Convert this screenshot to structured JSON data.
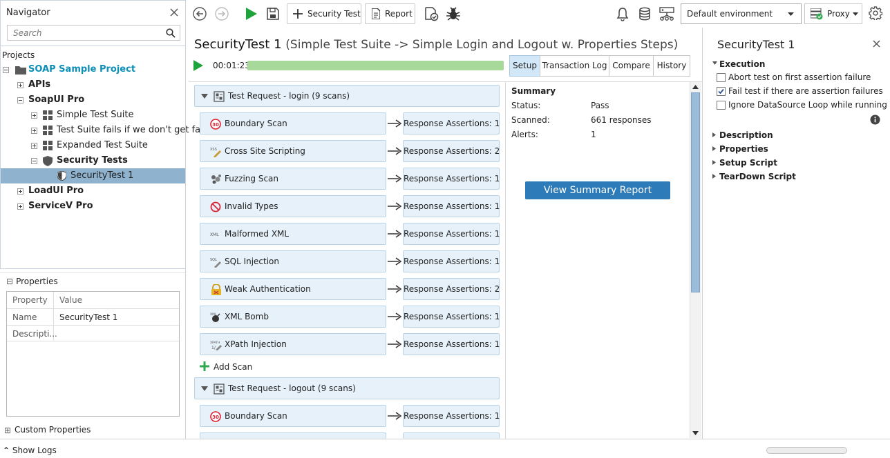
{
  "navigator": {
    "title": "Navigator",
    "search_placeholder": "Search",
    "projects_label": "Projects",
    "tree": [
      {
        "label": "SOAP Sample Project",
        "style": "teal-bold"
      },
      {
        "label": "APIs",
        "style": "bold"
      },
      {
        "label": "SoapUI Pro",
        "style": "bold"
      },
      {
        "label": "Simple Test Suite",
        "style": "normal"
      },
      {
        "label": "Test Suite fails if we don't get fa...",
        "style": "normal"
      },
      {
        "label": "Expanded Test Suite",
        "style": "normal"
      },
      {
        "label": "Security Tests",
        "style": "bold"
      },
      {
        "label": "SecurityTest 1",
        "style": "selected"
      },
      {
        "label": "LoadUI Pro",
        "style": "bold"
      },
      {
        "label": "ServiceV Pro",
        "style": "bold"
      }
    ]
  },
  "properties_panel": {
    "title": "Properties",
    "col_property": "Property",
    "col_value": "Value",
    "rows": [
      {
        "property": "Name",
        "value": "SecurityTest 1"
      },
      {
        "property": "Descripti...",
        "value": ""
      }
    ],
    "custom_properties": "Custom Properties"
  },
  "show_logs": "Show Logs",
  "toolbar": {
    "security_test_label": "Security Test",
    "report_label": "Report",
    "environment": "Default environment",
    "proxy_label": "Proxy"
  },
  "editor": {
    "title": "SecurityTest 1",
    "subtitle": "(Simple Test Suite -> Simple Login and Logout w. Properties Steps)",
    "elapsed": "00:01:23",
    "progress": 1.0,
    "tabs": [
      "Setup",
      "Transaction Log",
      "Compare",
      "History"
    ],
    "active_tab": "Setup"
  },
  "groups": [
    {
      "label": "Test Request - login (9 scans)",
      "scans": [
        {
          "name": "Boundary Scan",
          "icon": "boundary-icon",
          "assertions": "Response Assertions: 1"
        },
        {
          "name": "Cross Site Scripting",
          "icon": "xss-icon",
          "assertions": "Response Assertions: 2"
        },
        {
          "name": "Fuzzing Scan",
          "icon": "fuzzing-icon",
          "assertions": "Response Assertions: 1"
        },
        {
          "name": "Invalid Types",
          "icon": "invalid-types-icon",
          "assertions": "Response Assertions: 1"
        },
        {
          "name": "Malformed XML",
          "icon": "xml-icon",
          "assertions": "Response Assertions: 1"
        },
        {
          "name": "SQL Injection",
          "icon": "sql-icon",
          "assertions": "Response Assertions: 1"
        },
        {
          "name": "Weak Authentication",
          "icon": "weak-auth-icon",
          "assertions": "Response Assertions: 2"
        },
        {
          "name": "XML Bomb",
          "icon": "bomb-icon",
          "assertions": "Response Assertions: 1"
        },
        {
          "name": "XPath Injection",
          "icon": "xpath-icon",
          "assertions": "Response Assertions: 1"
        }
      ],
      "add_scan": "Add Scan"
    },
    {
      "label": "Test Request - logout (9 scans)",
      "scans": [
        {
          "name": "Boundary Scan",
          "icon": "boundary-icon",
          "assertions": "Response Assertions: 1"
        }
      ]
    }
  ],
  "summary": {
    "title": "Summary",
    "status_label": "Status:",
    "status_value": "Pass",
    "scanned_label": "Scanned:",
    "scanned_value": "661 responses",
    "alerts_label": "Alerts:",
    "alerts_value": "1",
    "view_report": "View Summary Report"
  },
  "inspector": {
    "title": "SecurityTest 1",
    "execution": "Execution",
    "options": [
      {
        "label": "Abort test on first assertion failure",
        "checked": false
      },
      {
        "label": "Fail test if there are assertion failures",
        "checked": true
      },
      {
        "label": "Ignore DataSource Loop while running test",
        "checked": false
      }
    ],
    "sections": [
      "Description",
      "Properties",
      "Setup Script",
      "TearDown Script"
    ]
  },
  "colors": {
    "accent": "#2d7bb8",
    "selected_row": "#8fb3cf",
    "scan_fill": "#e6f1fa",
    "progress_fill": "#a6d99a",
    "run_green": "#1fa33c"
  }
}
